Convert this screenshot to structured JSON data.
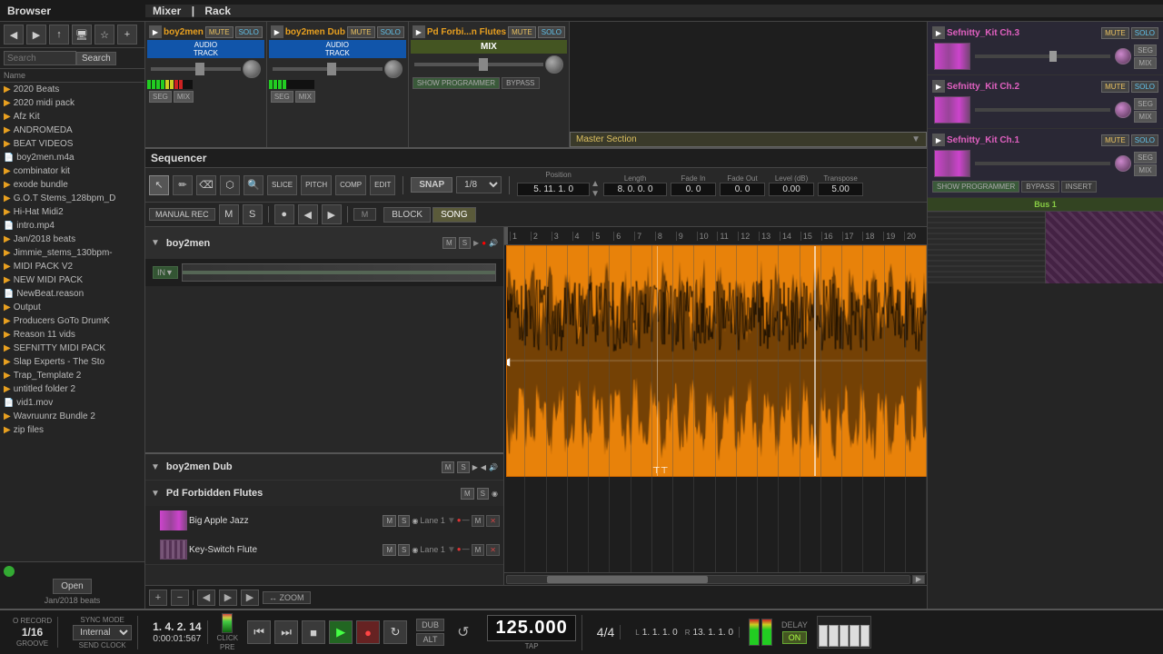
{
  "browser": {
    "title": "Browser",
    "current_folder": "Jan/2018 beats",
    "items": [
      {
        "name": "2020 Beats",
        "type": "folder"
      },
      {
        "name": "2020 midi pack",
        "type": "folder"
      },
      {
        "name": "Afz Kit",
        "type": "folder"
      },
      {
        "name": "ANDROMEDA",
        "type": "folder"
      },
      {
        "name": "BEAT VIDEOS",
        "type": "folder"
      },
      {
        "name": "boy2men.m4a",
        "type": "file"
      },
      {
        "name": "combinator kit",
        "type": "folder"
      },
      {
        "name": "exode bundle",
        "type": "folder"
      },
      {
        "name": "G.O.T Stems_128bpm_D",
        "type": "folder"
      },
      {
        "name": "Hi-Hat Midi2",
        "type": "folder"
      },
      {
        "name": "intro.mp4",
        "type": "file"
      },
      {
        "name": "Jan/2018 beats",
        "type": "folder"
      },
      {
        "name": "Jimmie_stems_130bpm-",
        "type": "folder"
      },
      {
        "name": "MIDI PACK V2",
        "type": "folder"
      },
      {
        "name": "NEW MIDI PACK",
        "type": "folder"
      },
      {
        "name": "NewBeat.reason",
        "type": "file"
      },
      {
        "name": "Output",
        "type": "folder"
      },
      {
        "name": "Producers GoTo DrumK",
        "type": "folder"
      },
      {
        "name": "Reason 11 vids",
        "type": "folder"
      },
      {
        "name": "SEFNITTY MIDI PACK",
        "type": "folder"
      },
      {
        "name": "Slap Experts - The Sto",
        "type": "folder"
      },
      {
        "name": "Trap_Template 2",
        "type": "folder"
      },
      {
        "name": "untitled folder 2",
        "type": "folder"
      },
      {
        "name": "vid1.mov",
        "type": "file"
      },
      {
        "name": "Wavruunrz Bundle  2",
        "type": "folder"
      },
      {
        "name": "zip files",
        "type": "folder"
      }
    ],
    "open_btn": "Open",
    "search_placeholder": "Search"
  },
  "mixer": {
    "title": "Mixer",
    "tracks": [
      {
        "name": "boy2men",
        "mute": "MUTE",
        "solo": "SOLO",
        "type": "audio",
        "label": "AUDIO\nTRACK"
      },
      {
        "name": "boy2men Dub",
        "mute": "MUTE",
        "solo": "SOLO",
        "type": "audio",
        "label": "AUDIO\nTRACK"
      },
      {
        "name": "Pd Forbi...n Flutes",
        "mute": "MUTE",
        "solo": "SOLO",
        "type": "mix",
        "label": "MIX"
      }
    ],
    "right_tracks": [
      {
        "name": "Sefnitty_Kit Ch.3",
        "mute": "MUTE",
        "solo": "SOLO"
      },
      {
        "name": "Sefnitty_Kit Ch.2",
        "mute": "MUTE",
        "solo": "SOLO"
      },
      {
        "name": "Sefnitty_Kit Ch.1",
        "mute": "MUTE",
        "solo": "SOLO"
      }
    ],
    "master_section": "Master Section",
    "bus_label": "Bus 1"
  },
  "rack": {
    "title": "Rack"
  },
  "sequencer": {
    "title": "Sequencer",
    "snap": "SNAP",
    "quantize": "1/8",
    "position": "5. 11. 1. 0",
    "length": "8. 0. 0. 0",
    "fade_in": "0. 0",
    "fade_out": "0. 0",
    "level_db": "0.00",
    "transpose": "5.00",
    "position_label": "Position",
    "length_label": "Length",
    "fade_in_label": "Fade In",
    "fade_out_label": "Fade Out",
    "level_label": "Level (dB)",
    "transpose_label": "Transpose",
    "manual_rec": "MANUAL REC",
    "block_label": "BLOCK",
    "song_label": "SONG",
    "tracks": [
      {
        "name": "boy2men",
        "type": "main",
        "expanded": true
      },
      {
        "name": "boy2men Dub",
        "type": "sub",
        "expanded": false
      },
      {
        "name": "Pd Forbidden Flutes",
        "type": "sub",
        "expanded": true,
        "sub_tracks": [
          {
            "name": "Big Apple Jazz",
            "lane": "Lane 1"
          },
          {
            "name": "Key-Switch Flute",
            "lane": "Lane 1"
          }
        ]
      }
    ],
    "timeline_marks": [
      "1",
      "2",
      "3",
      "4",
      "5",
      "6",
      "7",
      "8",
      "9",
      "10",
      "11",
      "12",
      "13",
      "14",
      "15",
      "16",
      "17",
      "18",
      "19",
      "20"
    ]
  },
  "transport": {
    "o_record": "O RECORD",
    "groove": "GROOVE",
    "quantize": "1/16",
    "sync": "SYNC MODE",
    "internal": "Internal",
    "send_clock": "SEND CLOCK",
    "position": "1. 4. 2. 14",
    "time_code": "0:00:01:567",
    "click": "CLICK",
    "pre": "PRE",
    "bpm": "125.000",
    "tap": "TAP",
    "time_sig": "4/4",
    "dub": "DUB",
    "alt": "ALT",
    "l_label": "L",
    "r_label": "R",
    "l_pos": "1. 1. 1. 0",
    "r_pos": "13. 1. 1. 0",
    "delay": "DELAY",
    "on": "ON"
  },
  "icons": {
    "folder": "📁",
    "file": "📄",
    "play": "▶",
    "stop": "■",
    "record": "●",
    "rewind": "⏮",
    "fast_forward": "⏭",
    "loop": "🔁",
    "zoom_in": "+",
    "zoom_out": "−",
    "cursor": "↖",
    "pencil": "✏",
    "eraser": "⌫",
    "magnet": "🔧",
    "arrow_left": "◀",
    "arrow_right": "▶",
    "speaker": "🔊",
    "headphones": "🎧"
  }
}
